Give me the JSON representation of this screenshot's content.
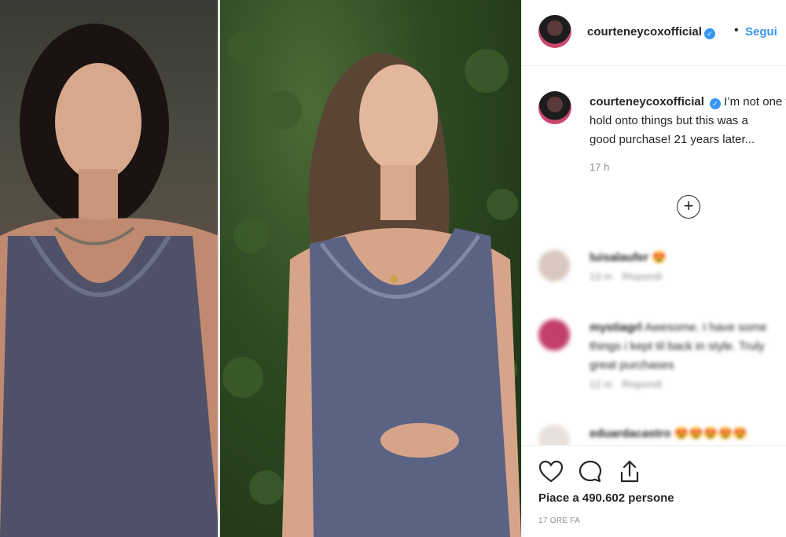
{
  "post": {
    "username": "courteneycoxofficial",
    "separator": "•",
    "follow_label": "Segui",
    "caption": "I’m not one to hold onto things but this was a good purchase! 21 years later...",
    "caption_time": "17 h",
    "load_more": "+",
    "likes": "Piace a 490.602 persone",
    "posted_ago": "17 ORE FA"
  },
  "comments": [
    {
      "username": "luisalaufer",
      "text": "😍",
      "time": "13 m",
      "reply": "Rispondi"
    },
    {
      "username": "mystiagrl",
      "text": "Awesome. I have some things i kept til back in style. Truly great purchases",
      "time": "12 m",
      "reply": "Rispondi"
    },
    {
      "username": "eduardacastro",
      "text": "😍😍😍😍😍",
      "time": "",
      "reply": ""
    }
  ],
  "colors": {
    "accent": "#3897f0",
    "text": "#262626",
    "muted": "#8e8e8e"
  },
  "icons": [
    "heart-icon",
    "comment-icon",
    "share-icon",
    "add-comment-icon",
    "verified-icon"
  ]
}
